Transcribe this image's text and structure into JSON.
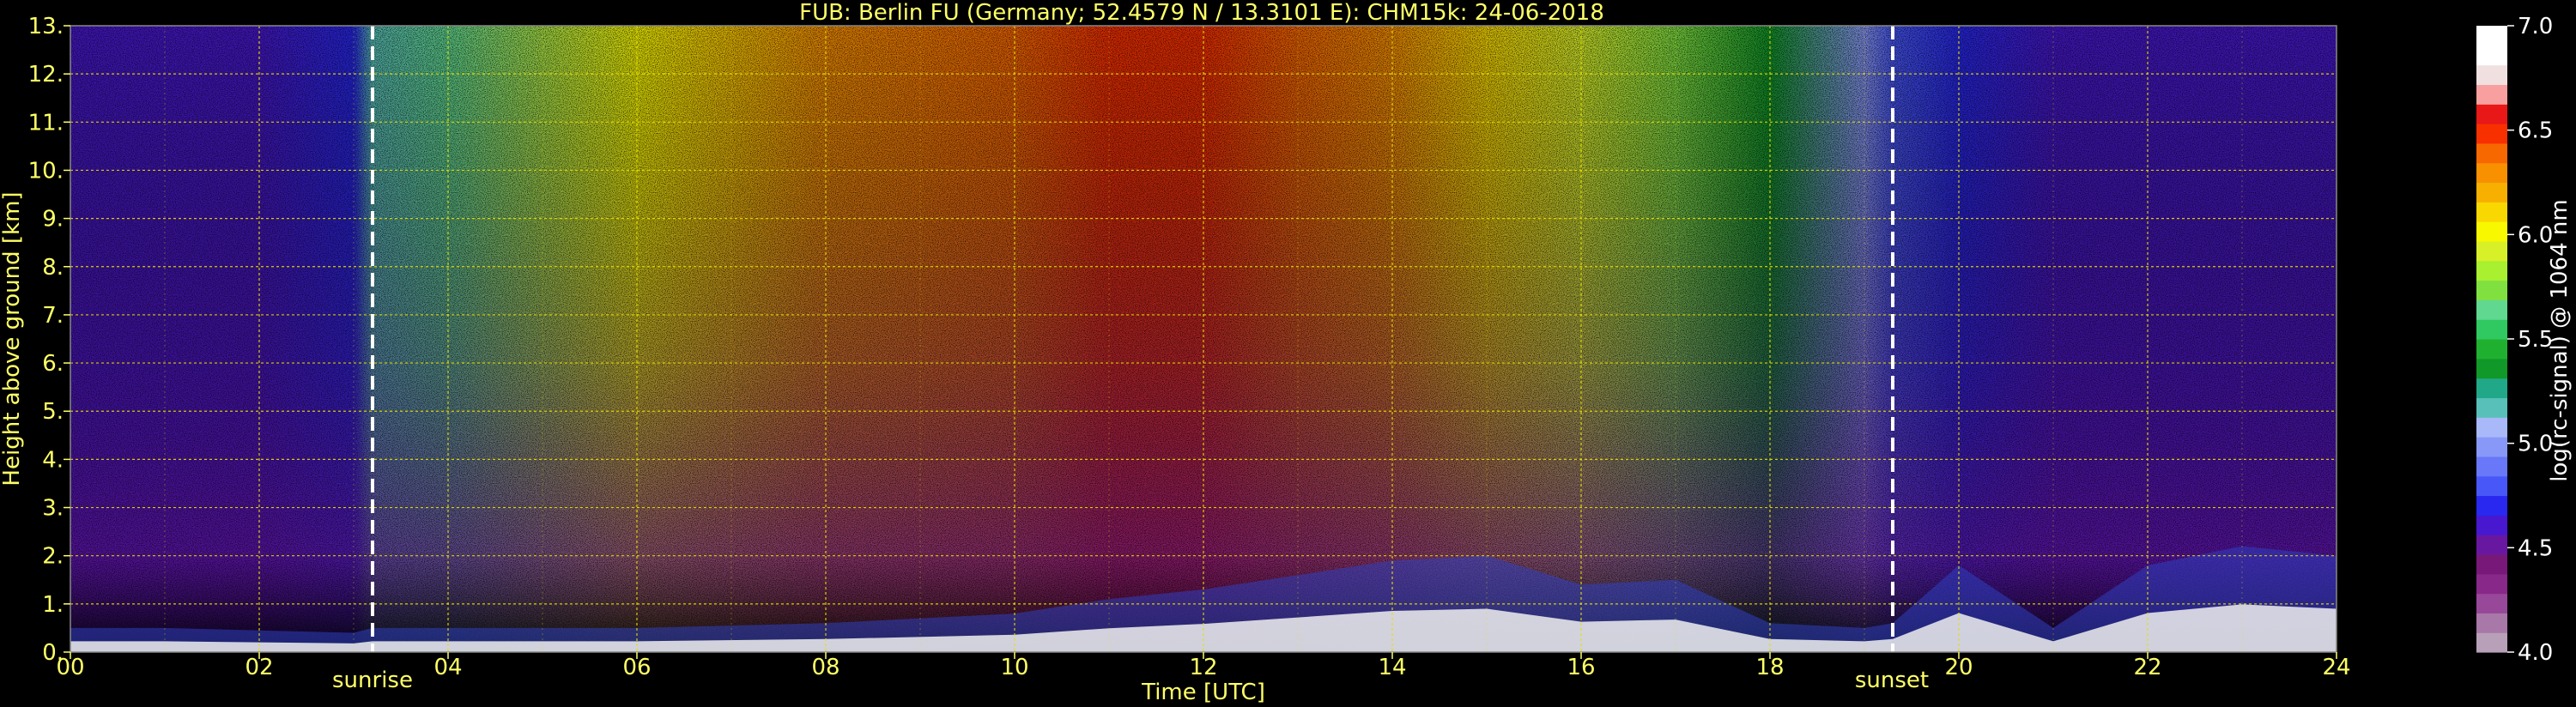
{
  "chart_data": {
    "type": "heatmap",
    "title": "FUB: Berlin FU (Germany; 52.4579 N / 13.3101 E):    CHM15k: 24-06-2018",
    "xlabel": "Time [UTC]",
    "ylabel": "Height above ground [km]",
    "xlim": [
      0,
      24
    ],
    "ylim": [
      0,
      13
    ],
    "x_ticks": [
      "00",
      "02",
      "04",
      "06",
      "08",
      "10",
      "12",
      "14",
      "16",
      "18",
      "20",
      "22",
      "24"
    ],
    "x_tick_values": [
      0,
      2,
      4,
      6,
      8,
      10,
      12,
      14,
      16,
      18,
      20,
      22,
      24
    ],
    "y_ticks": [
      "0.",
      "1.",
      "2.",
      "3.",
      "4.",
      "5.",
      "6.",
      "7.",
      "8.",
      "9.",
      "10.",
      "11.",
      "12.",
      "13."
    ],
    "y_tick_values": [
      0,
      1,
      2,
      3,
      4,
      5,
      6,
      7,
      8,
      9,
      10,
      11,
      12,
      13
    ],
    "grid": true,
    "annotations": [
      {
        "text": "sunrise",
        "x": 3.2
      },
      {
        "text": "sunset",
        "x": 19.3
      }
    ],
    "colorbar": {
      "label": "log(rc-signal) @ 1064 nm",
      "range": [
        4.0,
        7.0
      ],
      "ticks": [
        "4.0",
        "4.5",
        "5.0",
        "5.5",
        "6.0",
        "6.5",
        "7.0"
      ],
      "tick_values": [
        4.0,
        4.5,
        5.0,
        5.5,
        6.0,
        6.5,
        7.0
      ],
      "colors": [
        "#b8a0b8",
        "#a878a8",
        "#984898",
        "#882888",
        "#781878",
        "#6818a0",
        "#4818d0",
        "#2828f0",
        "#4858f8",
        "#6878f8",
        "#8898f8",
        "#a8b8f8",
        "#58c0b8",
        "#20a888",
        "#109828",
        "#20b030",
        "#30c860",
        "#60d890",
        "#80e040",
        "#a8f030",
        "#d8f028",
        "#f8f800",
        "#f8d800",
        "#f8b000",
        "#f89000",
        "#f86800",
        "#f83000",
        "#e81818",
        "#f8a0a0",
        "#f0e0e0",
        "#ffffff",
        "#ffffff"
      ]
    },
    "summary_signal": {
      "x_hours": [
        0,
        1,
        2,
        3,
        3.2,
        4,
        6,
        8,
        10,
        11,
        12,
        13,
        14,
        15,
        16,
        17,
        18,
        19,
        19.3,
        20,
        21,
        22,
        23,
        24
      ],
      "boundary_layer_top_km": [
        0.5,
        0.5,
        0.45,
        0.4,
        0.5,
        0.5,
        0.5,
        0.6,
        0.8,
        1.1,
        1.3,
        1.6,
        1.9,
        2.0,
        1.4,
        1.5,
        0.6,
        0.5,
        0.6,
        1.8,
        0.5,
        1.8,
        2.2,
        2.0
      ],
      "background_log_signal": [
        4.6,
        4.6,
        4.6,
        4.7,
        5.2,
        5.6,
        6.0,
        6.3,
        6.4,
        6.5,
        6.5,
        6.4,
        6.3,
        6.1,
        5.9,
        5.7,
        5.4,
        5.0,
        4.8,
        4.7,
        4.6,
        4.6,
        4.6,
        4.6
      ]
    },
    "colors": {
      "text": "#ffff66",
      "grid": "#e8e000",
      "markers": "#ffffff"
    }
  }
}
